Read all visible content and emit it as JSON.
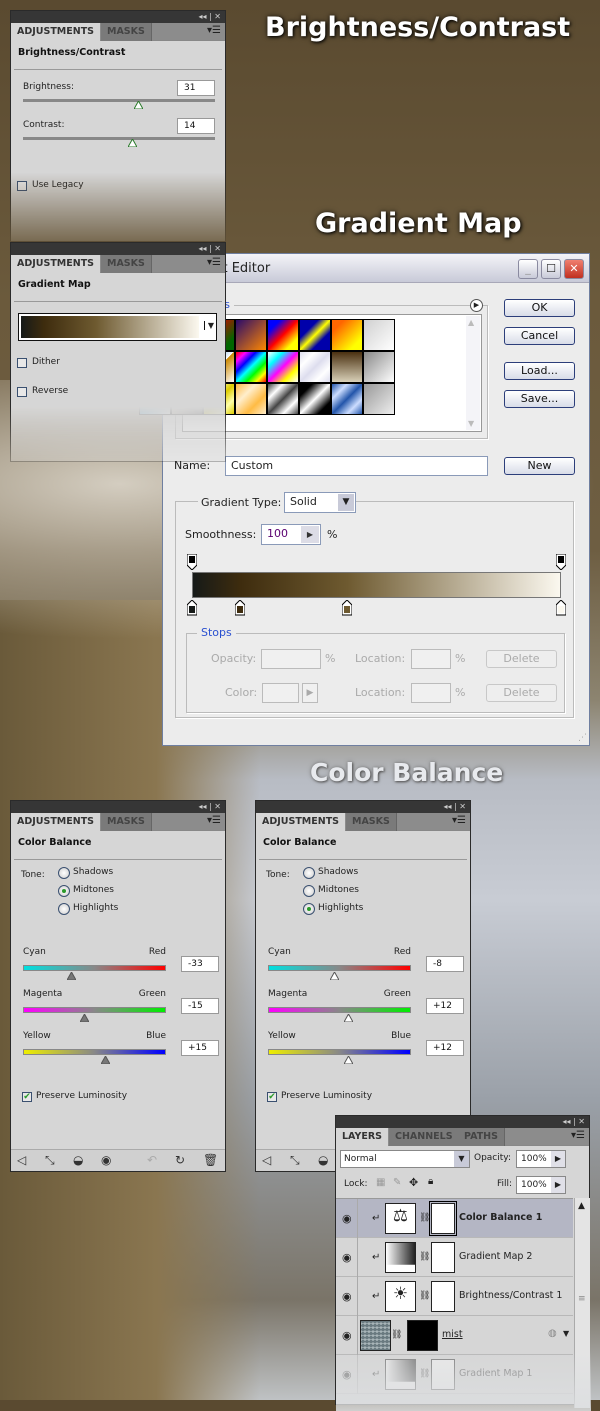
{
  "headings": {
    "brightness_contrast": "Brightness/Contrast",
    "gradient_map": "Gradient Map",
    "color_balance": "Color Balance"
  },
  "bc_panel": {
    "tabs": [
      "ADJUSTMENTS",
      "MASKS"
    ],
    "title": "Brightness/Contrast",
    "brightness_label": "Brightness:",
    "brightness_value": "31",
    "contrast_label": "Contrast:",
    "contrast_value": "14",
    "use_legacy_label": "Use Legacy",
    "use_legacy_checked": false
  },
  "gm_panel": {
    "tabs": [
      "ADJUSTMENTS",
      "MASKS"
    ],
    "title": "Gradient Map",
    "dither_label": "Dither",
    "dither_checked": false,
    "reverse_label": "Reverse",
    "reverse_checked": false
  },
  "gradient_editor": {
    "title": "Gradient Editor",
    "presets_label": "Presets",
    "ok": "OK",
    "cancel": "Cancel",
    "load": "Load...",
    "save": "Save...",
    "name_label": "Name:",
    "name_value": "Custom",
    "new": "New",
    "gradient_type_label": "Gradient Type:",
    "gradient_type_value": "Solid",
    "smoothness_label": "Smoothness:",
    "smoothness_value": "100",
    "percent": "%",
    "stops_label": "Stops",
    "opacity_label": "Opacity:",
    "color_label": "Color:",
    "location_label": "Location:",
    "delete": "Delete",
    "color_stops": [
      {
        "location": 0,
        "color": "#161a18"
      },
      {
        "location": 13,
        "color": "#3e2c0e"
      },
      {
        "location": 42,
        "color": "#6e5a30"
      },
      {
        "location": 100,
        "color": "#fbf8ef"
      }
    ]
  },
  "cb_panels": [
    {
      "tabs": [
        "ADJUSTMENTS",
        "MASKS"
      ],
      "title": "Color Balance",
      "tone_label": "Tone:",
      "tones": [
        "Shadows",
        "Midtones",
        "Highlights"
      ],
      "selected_tone": "Midtones",
      "sliders": [
        {
          "left": "Cyan",
          "right": "Red",
          "value": "-33"
        },
        {
          "left": "Magenta",
          "right": "Green",
          "value": "-15"
        },
        {
          "left": "Yellow",
          "right": "Blue",
          "value": "+15"
        }
      ],
      "preserve_label": "Preserve Luminosity",
      "preserve_checked": true
    },
    {
      "tabs": [
        "ADJUSTMENTS",
        "MASKS"
      ],
      "title": "Color Balance",
      "tone_label": "Tone:",
      "tones": [
        "Shadows",
        "Midtones",
        "Highlights"
      ],
      "selected_tone": "Highlights",
      "sliders": [
        {
          "left": "Cyan",
          "right": "Red",
          "value": "-8"
        },
        {
          "left": "Magenta",
          "right": "Green",
          "value": "+12"
        },
        {
          "left": "Yellow",
          "right": "Blue",
          "value": "+12"
        }
      ],
      "preserve_label": "Preserve Luminosity",
      "preserve_checked": true
    }
  ],
  "layers_panel": {
    "tabs": [
      "LAYERS",
      "CHANNELS",
      "PATHS"
    ],
    "blend_mode": "Normal",
    "opacity_label": "Opacity:",
    "opacity_value": "100%",
    "lock_label": "Lock:",
    "fill_label": "Fill:",
    "fill_value": "100%",
    "layers": [
      {
        "name": "Color Balance 1",
        "selected": true,
        "icon": "balance-scale-icon"
      },
      {
        "name": "Gradient Map 2",
        "selected": false,
        "icon": "gradient-icon"
      },
      {
        "name": "Brightness/Contrast 1",
        "selected": false,
        "icon": "sun-icon"
      },
      {
        "name": "mist",
        "selected": false,
        "icon": "texture-thumbnail"
      },
      {
        "name": "Gradient Map 1",
        "selected": false,
        "icon": "gradient-icon"
      }
    ]
  }
}
